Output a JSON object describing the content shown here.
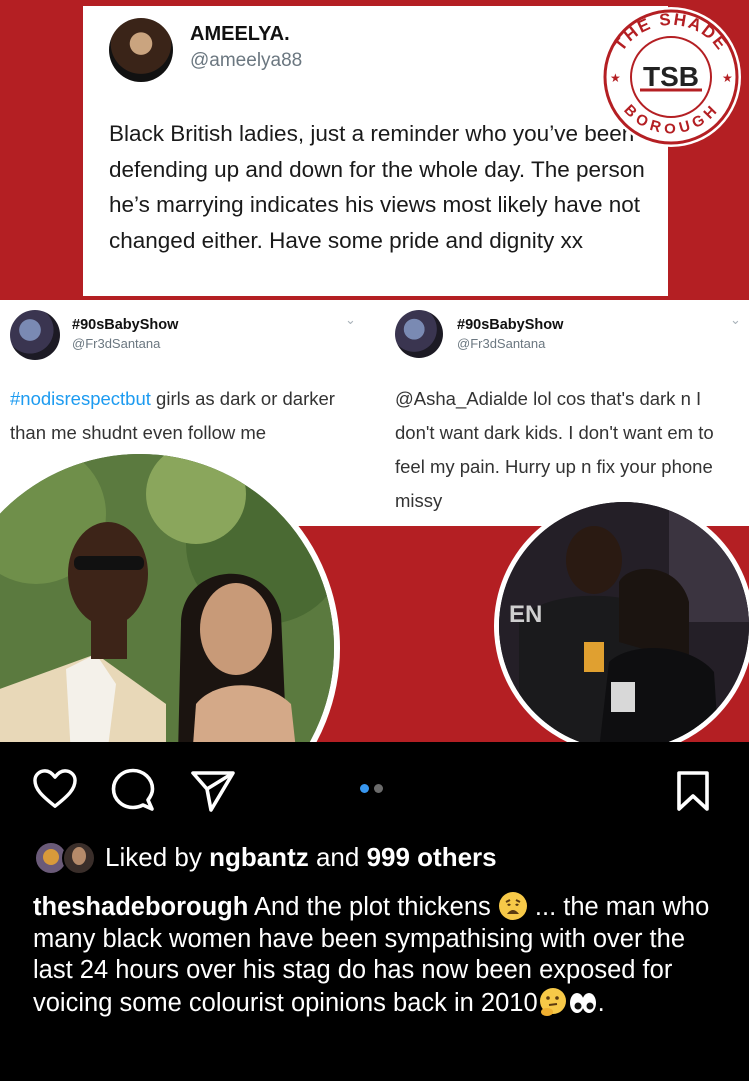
{
  "post_image": {
    "tweet_top": {
      "display_name": "AMEELYA.",
      "handle": "@ameelya88",
      "text": "Black British ladies, just a reminder who you’ve been defending up and down for the whole day. The person he’s marrying indicates his views most likely have not changed either. Have some pride and dignity xx"
    },
    "logo": {
      "top_text": "THE SHADE",
      "bottom_text": "BOROUGH",
      "mark": "TSB"
    },
    "tweet_left": {
      "display_name": "#90sBabyShow",
      "handle": "@Fr3dSantana",
      "hashtag": "#nodisrespectbut",
      "text": " girls as dark or darker than me shudnt even follow me"
    },
    "tweet_right": {
      "display_name": "#90sBabyShow",
      "handle": "@Fr3dSantana",
      "text": "@Asha_Adialde lol cos that's dark n I don't want dark kids. I don't want em to feel my pain. Hurry up n fix your phone missy"
    }
  },
  "carousel": {
    "current": 1,
    "total": 2
  },
  "likes": {
    "prefix": "Liked by ",
    "user": "ngbantz",
    "middle": " and ",
    "others": "999 others"
  },
  "caption": {
    "username": "theshadeborough",
    "part1": " And the plot thickens ",
    "part2": " ... the man who many black women have been sympathising with over the last 24 hours over his stag do has now been exposed for voicing some colourist opinions back in 2010",
    "part3": "."
  },
  "colors": {
    "brand_red": "#b41f23",
    "link_blue": "#1d9bf0",
    "active_dot": "#3897f0"
  }
}
